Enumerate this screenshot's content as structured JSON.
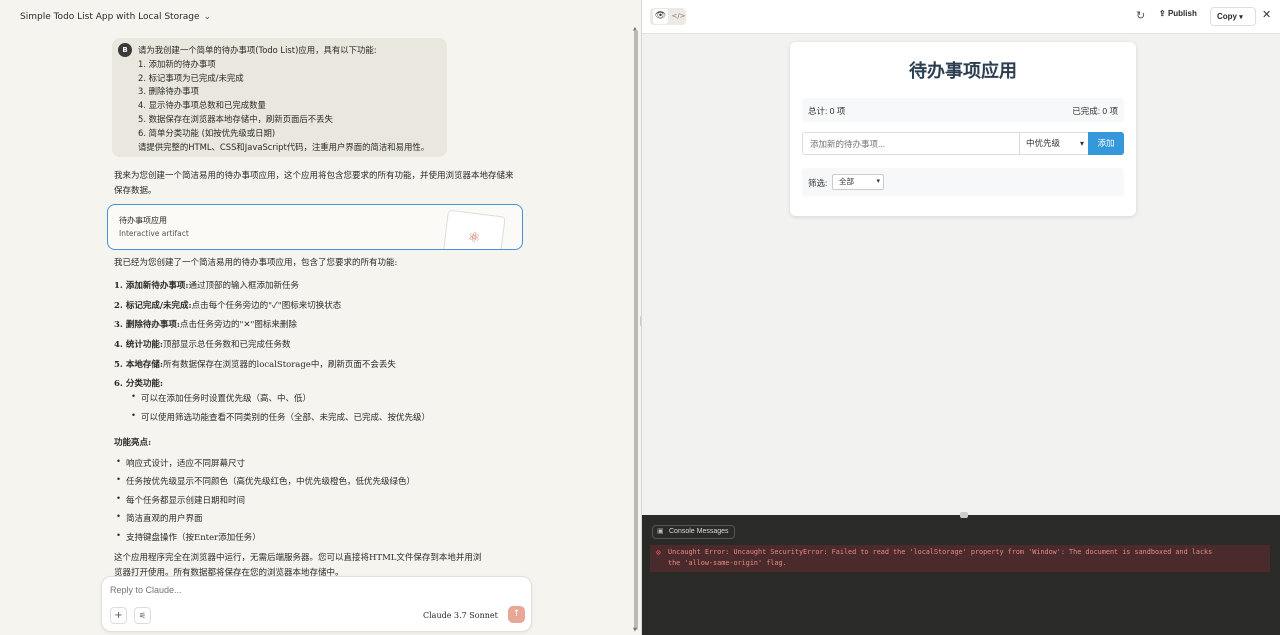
{
  "conversation": {
    "title": "Simple Todo List App with Local Storage",
    "chevron_icon": "chevron-down-icon"
  },
  "user_message": {
    "avatar": "B",
    "lines": [
      "请为我创建一个简单的待办事项(Todo List)应用，具有以下功能:",
      "1. 添加新的待办事项",
      "2. 标记事项为已完成/未完成",
      "3. 删除待办事项",
      "4. 显示待办事项总数和已完成数量",
      "5. 数据保存在浏览器本地存储中，刷新页面后不丢失",
      "6. 简单分类功能 (如按优先级或日期)",
      "请提供完整的HTML、CSS和JavaScript代码，注重用户界面的简洁和易用性。"
    ]
  },
  "assistant": {
    "intro": "我来为您创建一个简洁易用的待办事项应用，这个应用将包含您要求的所有功能，并使用浏览器本地存储来保存数据。",
    "artifact": {
      "title": "待办事项应用",
      "subtitle": "Interactive artifact"
    },
    "summary": "我已经为您创建了一个简洁易用的待办事项应用，包含了您要求的所有功能:",
    "features": [
      {
        "label": "1. 添加新待办事项:",
        "text": "通过顶部的输入框添加新任务"
      },
      {
        "label": "2. 标记完成/未完成:",
        "text": "点击每个任务旁边的\"✓\"图标来切换状态"
      },
      {
        "label": "3. 删除待办事项:",
        "text": "点击任务旁边的\"✕\"图标来删除"
      },
      {
        "label": "4. 统计功能:",
        "text": "顶部显示总任务数和已完成任务数"
      },
      {
        "label": "5. 本地存储:",
        "text": "所有数据保存在浏览器的localStorage中，刷新页面不会丢失"
      },
      {
        "label": "6. 分类功能:",
        "text": ""
      }
    ],
    "sub_bullets": [
      "可以在添加任务时设置优先级（高、中、低）",
      "可以使用筛选功能查看不同类别的任务（全部、未完成、已完成、按优先级）"
    ],
    "highlights_title": "功能亮点:",
    "highlights": [
      "响应式设计，适应不同屏幕尺寸",
      "任务按优先级显示不同颜色（高优先级红色，中优先级橙色，低优先级绿色）",
      "每个任务都显示创建日期和时间",
      "简洁直观的用户界面",
      "支持键盘操作（按Enter添加任务）"
    ],
    "closing_line1": "这个应用程序完全在浏览器中运行，无需后端服务器。您可以直接将HTML文件保存到本地并用浏",
    "closing_line2": "览器打开使用。所有数据都将保存在您的浏览器本地存储中。"
  },
  "composer": {
    "placeholder": "Reply to Claude...",
    "plus_icon": "plus-icon",
    "settings_icon": "sliders-icon",
    "model": "Claude 3.7 Sonnet",
    "send_icon": "arrow-up-icon"
  },
  "artifact_toolbar": {
    "preview_icon": "eye-icon",
    "code_icon": "code-icon",
    "refresh_icon": "refresh-icon",
    "publish_label": "Publish",
    "copy_label": "Copy",
    "close_icon": "close-icon"
  },
  "todo_app": {
    "title": "待办事项应用",
    "total": "总计: 0 项",
    "completed": "已完成: 0 项",
    "input_placeholder": "添加新的待办事项...",
    "priority_selected": "中优先级",
    "add_label": "添加",
    "filter_label": "筛选:",
    "filter_selected": "全部"
  },
  "console": {
    "tab_label": "Console Messages",
    "error_line1": "Uncaught Error: Uncaught SecurityError: Failed to read the 'localStorage' property from 'Window': The document is sandboxed and lacks",
    "error_line2": "the 'allow-same-origin' flag."
  }
}
